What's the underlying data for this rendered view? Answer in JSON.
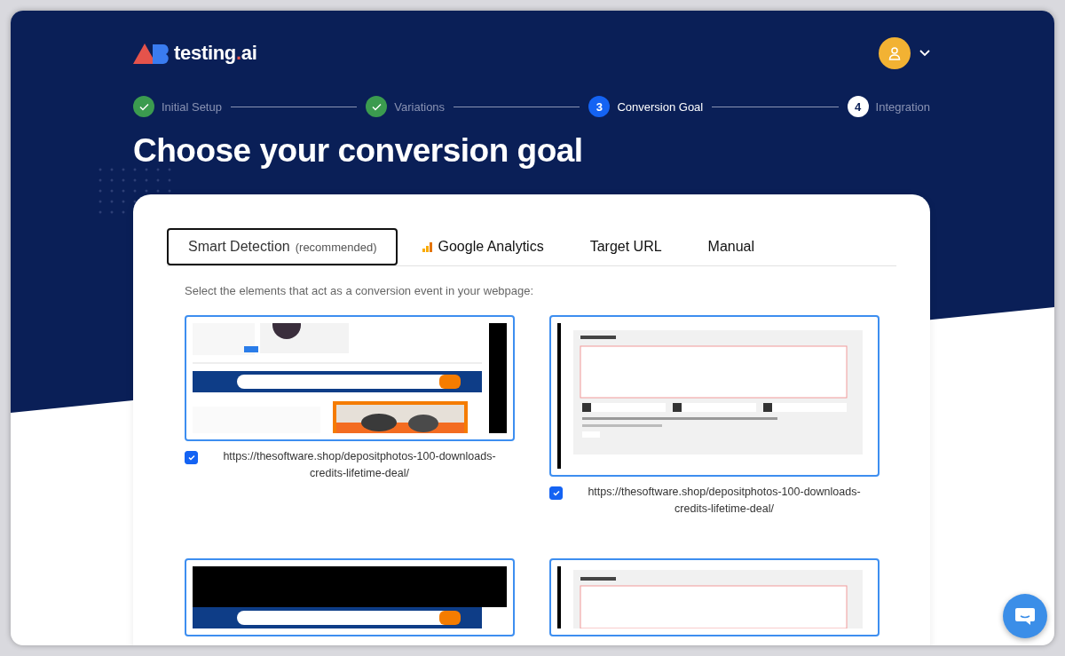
{
  "logo": {
    "name": "testing",
    "accent": ".",
    "suffix": "ai"
  },
  "steps": [
    {
      "label": "Initial Setup",
      "completed": true,
      "current": false
    },
    {
      "label": "Variations",
      "completed": true,
      "current": false
    },
    {
      "label": "Conversion Goal",
      "number": "3",
      "completed": false,
      "current": true
    },
    {
      "label": "Integration",
      "number": "4",
      "completed": false,
      "current": false
    }
  ],
  "title": "Choose your conversion goal",
  "tabs": [
    {
      "label": "Smart Detection",
      "note": "(recommended)",
      "kind": "plain",
      "selected": true
    },
    {
      "label": "Google Analytics",
      "kind": "analytics",
      "selected": false
    },
    {
      "label": "Target URL",
      "kind": "plain",
      "selected": false
    },
    {
      "label": "Manual",
      "kind": "plain",
      "selected": false
    }
  ],
  "instruction": "Select the elements that act as a conversion event in your webpage:",
  "cards": [
    {
      "kind": "shop",
      "checked": true,
      "url": "https://thesoftware.shop/depositphotos-100-downloads-credits-lifetime-deal/"
    },
    {
      "kind": "reply",
      "checked": true,
      "url": "https://thesoftware.shop/depositphotos-100-downloads-credits-lifetime-deal/"
    },
    {
      "kind": "video"
    },
    {
      "kind": "reply-top"
    }
  ]
}
